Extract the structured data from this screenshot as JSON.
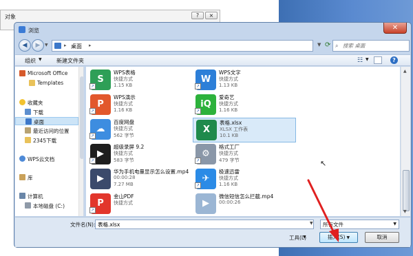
{
  "background_dialog": {
    "title": "对象",
    "help_label": "?",
    "close_label": "×"
  },
  "window": {
    "title": "浏览",
    "close_label": "✕"
  },
  "address": {
    "breadcrumb": "桌面",
    "separator": "▸",
    "arrow": "▸"
  },
  "search": {
    "placeholder": "搜索 桌面"
  },
  "toolbar": {
    "organize_label": "组织",
    "newfolder_label": "新建文件夹",
    "help_label": "?"
  },
  "nav": {
    "items": [
      {
        "label": "Microsoft Office",
        "icon": "office-icon"
      },
      {
        "label": "Templates",
        "icon": "folder-icon"
      },
      {
        "label": "收藏夹",
        "icon": "star-icon"
      },
      {
        "label": "下载",
        "icon": "download-folder-icon"
      },
      {
        "label": "桌面",
        "icon": "desktop-icon"
      },
      {
        "label": "最近访问的位置",
        "icon": "recent-icon"
      },
      {
        "label": "2345下载",
        "icon": "folder-icon"
      },
      {
        "label": "WPS云文档",
        "icon": "cloud-icon"
      },
      {
        "label": "库",
        "icon": "library-icon"
      },
      {
        "label": "计算机",
        "icon": "computer-icon"
      },
      {
        "label": "本地磁盘 (C:)",
        "icon": "disk-icon"
      }
    ]
  },
  "files": [
    {
      "name": "WPS表格",
      "type": "快捷方式",
      "size": "1.15 KB",
      "icon": "wps-spreadsheet-icon",
      "color": "#2e9f57",
      "glyph": "S"
    },
    {
      "name": "WPS文字",
      "type": "快捷方式",
      "size": "1.13 KB",
      "icon": "wps-writer-icon",
      "color": "#2d7fd8",
      "glyph": "W"
    },
    {
      "name": "WPS演示",
      "type": "快捷方式",
      "size": "1.16 KB",
      "icon": "wps-presentation-icon",
      "color": "#e2582c",
      "glyph": "P"
    },
    {
      "name": "爱奇艺",
      "type": "快捷方式",
      "size": "1.16 KB",
      "icon": "iqiyi-icon",
      "color": "#2db23c",
      "glyph": "iQ"
    },
    {
      "name": "百度网盘",
      "type": "快捷方式",
      "size": "562 字节",
      "icon": "baidu-netdisk-icon",
      "color": "#3d8de0",
      "glyph": "☁"
    },
    {
      "name": "表格.xlsx",
      "type": "XLSX 工作表",
      "size": "10.1 KB",
      "icon": "xlsx-file-icon",
      "color": "#1f8a4c",
      "glyph": "X"
    },
    {
      "name": "超级录屏 9.2",
      "type": "快捷方式",
      "size": "583 字节",
      "icon": "screen-recorder-icon",
      "color": "#1e1e1e",
      "glyph": "▶"
    },
    {
      "name": "格式工厂",
      "type": "快捷方式",
      "size": "479 字节",
      "icon": "format-factory-icon",
      "color": "#8a97a8",
      "glyph": "⚙"
    },
    {
      "name": "华为手机电量显示怎么设置.mp4",
      "type": "00:00:28",
      "size": "7.27 MB",
      "icon": "video-thumb-icon",
      "color": "#3b4a6b",
      "glyph": "▶"
    },
    {
      "name": "极速迅雷",
      "type": "快捷方式",
      "size": "1.16 KB",
      "icon": "xunlei-icon",
      "color": "#2b8be6",
      "glyph": "✈"
    },
    {
      "name": "金山PDF",
      "type": "快捷方式",
      "size": "",
      "icon": "kingsoft-pdf-icon",
      "color": "#e2362c",
      "glyph": "P"
    },
    {
      "name": "微信短信怎么拦截.mp4",
      "type": "00:00:26",
      "size": "",
      "icon": "video-file-icon",
      "color": "#9bb6d4",
      "glyph": "▶"
    }
  ],
  "bottom": {
    "filename_label": "文件名(N):",
    "filename_value": "表格.xlsx",
    "type_value": "所有文件",
    "tools_label": "工具(L)",
    "insert_label": "插入(S)",
    "cancel_label": "取消"
  },
  "colors": {
    "annotation_arrow": "#e02020",
    "selection": "#d9eaf9"
  }
}
